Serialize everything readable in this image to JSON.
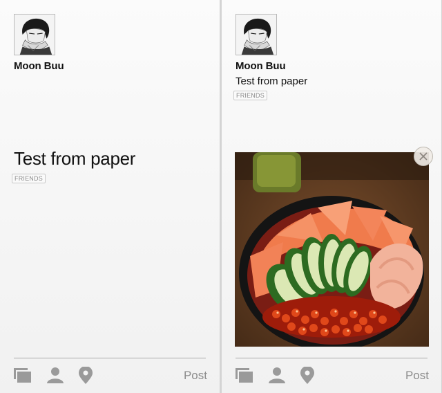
{
  "left_panel": {
    "username": "Moon Buu",
    "post_text": "Test from paper",
    "audience_badge": "FRIENDS",
    "post_button": "Post"
  },
  "right_panel": {
    "username": "Moon Buu",
    "post_text": "Test from paper",
    "audience_badge": "FRIENDS",
    "post_button": "Post"
  },
  "icons": [
    "cards-icon",
    "person-icon",
    "location-pin-icon",
    "close-icon",
    "avatar"
  ],
  "colors": {
    "background": "#f4f4f4",
    "text": "#111111",
    "muted": "#8c8c8c",
    "icon": "#9a9a9a"
  }
}
